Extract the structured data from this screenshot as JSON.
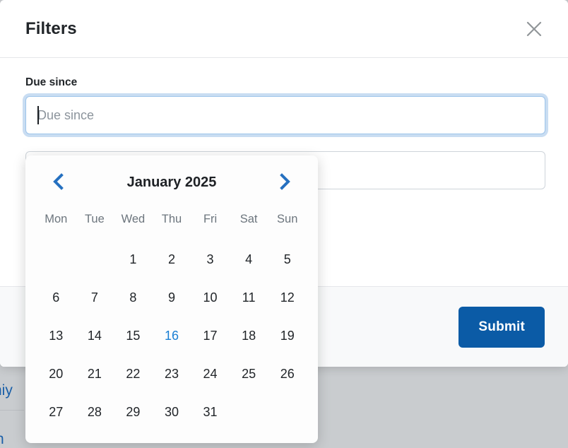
{
  "background": {
    "fragments": [
      {
        "text": "niy"
      },
      {
        "text": "n"
      }
    ]
  },
  "modal": {
    "title": "Filters",
    "close_icon": "close-icon",
    "fields": [
      {
        "label": "Due since",
        "placeholder": "Due since",
        "value": "",
        "focused": true
      },
      {
        "label": "",
        "placeholder": "",
        "value": "",
        "focused": false
      }
    ],
    "footer": {
      "submit_label": "Submit"
    }
  },
  "datepicker": {
    "prev_icon": "chevron-left-icon",
    "next_icon": "chevron-right-icon",
    "month_label": "January 2025",
    "weekdays": [
      "Mon",
      "Tue",
      "Wed",
      "Thu",
      "Fri",
      "Sat",
      "Sun"
    ],
    "leading_blanks": 2,
    "days": [
      1,
      2,
      3,
      4,
      5,
      6,
      7,
      8,
      9,
      10,
      11,
      12,
      13,
      14,
      15,
      16,
      17,
      18,
      19,
      20,
      21,
      22,
      23,
      24,
      25,
      26,
      27,
      28,
      29,
      30,
      31
    ],
    "today": 16,
    "selected": null
  },
  "colors": {
    "accent_blue": "#0b5ba6",
    "today_blue": "#1a7fd4",
    "nav_blue": "#2570c0",
    "backdrop_gray": "#c9cccf",
    "footer_gray": "#f8f9fa",
    "muted_text": "#6c757d"
  }
}
